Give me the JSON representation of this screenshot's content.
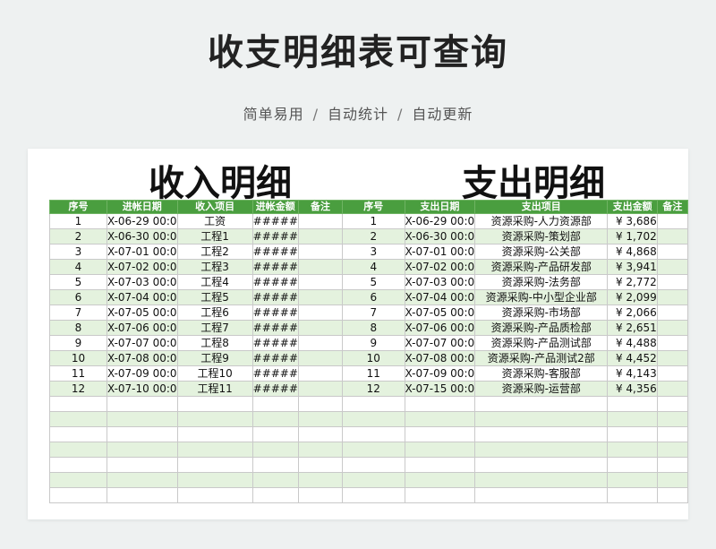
{
  "page": {
    "title": "收支明细表可查询",
    "features": [
      "简单易用",
      "自动统计",
      "自动更新"
    ],
    "separator": "/"
  },
  "income": {
    "heading": "收入明细",
    "columns": [
      "序号",
      "进帐日期",
      "收入项目",
      "进帐金额",
      "备注"
    ],
    "rows": [
      {
        "no": "1",
        "date": "X-06-29 00:0",
        "item": "工资",
        "amount": "#####",
        "note": ""
      },
      {
        "no": "2",
        "date": "X-06-30 00:0",
        "item": "工程1",
        "amount": "#####",
        "note": ""
      },
      {
        "no": "3",
        "date": "X-07-01 00:0",
        "item": "工程2",
        "amount": "#####",
        "note": ""
      },
      {
        "no": "4",
        "date": "X-07-02 00:0",
        "item": "工程3",
        "amount": "#####",
        "note": ""
      },
      {
        "no": "5",
        "date": "X-07-03 00:0",
        "item": "工程4",
        "amount": "#####",
        "note": ""
      },
      {
        "no": "6",
        "date": "X-07-04 00:0",
        "item": "工程5",
        "amount": "#####",
        "note": ""
      },
      {
        "no": "7",
        "date": "X-07-05 00:0",
        "item": "工程6",
        "amount": "#####",
        "note": ""
      },
      {
        "no": "8",
        "date": "X-07-06 00:0",
        "item": "工程7",
        "amount": "#####",
        "note": ""
      },
      {
        "no": "9",
        "date": "X-07-07 00:0",
        "item": "工程8",
        "amount": "#####",
        "note": ""
      },
      {
        "no": "10",
        "date": "X-07-08 00:0",
        "item": "工程9",
        "amount": "#####",
        "note": ""
      },
      {
        "no": "11",
        "date": "X-07-09 00:0",
        "item": "工程10",
        "amount": "#####",
        "note": ""
      },
      {
        "no": "12",
        "date": "X-07-10 00:0",
        "item": "工程11",
        "amount": "#####",
        "note": ""
      }
    ]
  },
  "expense": {
    "heading": "支出明细",
    "columns": [
      "序号",
      "支出日期",
      "支出项目",
      "支出金额",
      "备注"
    ],
    "rows": [
      {
        "no": "1",
        "date": "X-06-29 00:0",
        "item": "资源采购-人力资源部",
        "amount": "¥ 3,686",
        "note": ""
      },
      {
        "no": "2",
        "date": "X-06-30 00:0",
        "item": "资源采购-策划部",
        "amount": "¥ 1,702",
        "note": ""
      },
      {
        "no": "3",
        "date": "X-07-01 00:0",
        "item": "资源采购-公关部",
        "amount": "¥ 4,868",
        "note": ""
      },
      {
        "no": "4",
        "date": "X-07-02 00:0",
        "item": "资源采购-产品研发部",
        "amount": "¥ 3,941",
        "note": ""
      },
      {
        "no": "5",
        "date": "X-07-03 00:0",
        "item": "资源采购-法务部",
        "amount": "¥ 2,772",
        "note": ""
      },
      {
        "no": "6",
        "date": "X-07-04 00:0",
        "item": "资源采购-中小型企业部",
        "amount": "¥ 2,099",
        "note": ""
      },
      {
        "no": "7",
        "date": "X-07-05 00:0",
        "item": "资源采购-市场部",
        "amount": "¥ 2,066",
        "note": ""
      },
      {
        "no": "8",
        "date": "X-07-06 00:0",
        "item": "资源采购-产品质检部",
        "amount": "¥ 2,651",
        "note": ""
      },
      {
        "no": "9",
        "date": "X-07-07 00:0",
        "item": "资源采购-产品测试部",
        "amount": "¥ 4,488",
        "note": ""
      },
      {
        "no": "10",
        "date": "X-07-08 00:0",
        "item": "资源采购-产品测试2部",
        "amount": "¥ 4,452",
        "note": ""
      },
      {
        "no": "11",
        "date": "X-07-09 00:0",
        "item": "资源采购-客服部",
        "amount": "¥ 4,143",
        "note": ""
      },
      {
        "no": "12",
        "date": "X-07-15 00:0",
        "item": "资源采购-运营部",
        "amount": "¥ 4,356",
        "note": ""
      }
    ]
  },
  "colors": {
    "header_green": "#4a9e3f",
    "row_alt": "#e4f2de",
    "grid_line": "#c9c9c9"
  }
}
